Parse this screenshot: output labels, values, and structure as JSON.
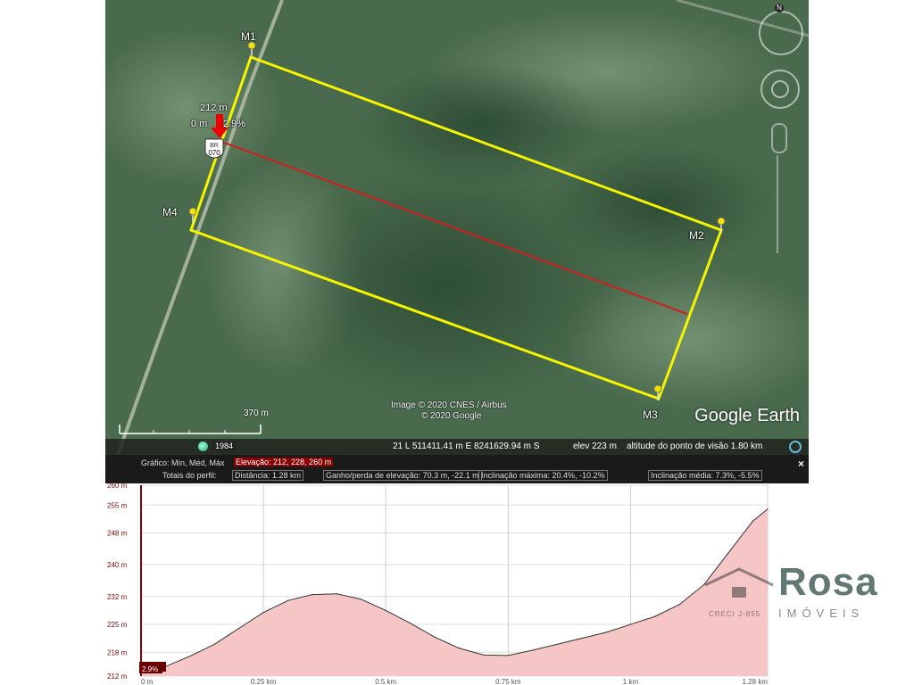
{
  "map": {
    "markers": [
      {
        "name": "m1",
        "label": "M1"
      },
      {
        "name": "m2",
        "label": "M2"
      },
      {
        "name": "m3",
        "label": "M3"
      },
      {
        "name": "m4",
        "label": "M4"
      }
    ],
    "cursor": {
      "elevation": "212 m",
      "distance": "0 m",
      "slope": "2.9%"
    },
    "road_shield": {
      "top": "BR",
      "number": "070"
    },
    "credits": {
      "imagery": "Image © 2020 CNES / Airbus",
      "copyright": "© 2020 Google"
    },
    "logo": "Google Earth",
    "scale_label": "370 m",
    "compass": "N"
  },
  "statusbar": {
    "year": "1984",
    "coords": "21 L 511411.41 m E 8241629.94 m S",
    "elev": "elev  223 m",
    "eye_alt": "altitude do ponto de visão   1.80 km"
  },
  "panel": {
    "graph_label": "Gráfico: Mín, Méd, Máx",
    "elevation_summary": "Elevação: 212, 228, 260 m",
    "totals_label": "Totais do perfil:",
    "distance": "Distância: 1.28 km",
    "gain_loss": "Ganho/perda de elevação: 70.3 m, -22.1 m",
    "max_slope": "Inclinação máxima: 20.4%, -10.2%",
    "avg_slope": "Inclinação média: 7.3%, -5.5%",
    "close": "×",
    "cursor_elev": "212 m",
    "cursor_slope": "2.9%"
  },
  "chart_data": {
    "type": "area",
    "xlabel": "",
    "ylabel": "",
    "x_unit": "km",
    "x_ticks": [
      {
        "value": 0,
        "label": "0 m"
      },
      {
        "value": 0.25,
        "label": "0.25 km"
      },
      {
        "value": 0.5,
        "label": "0.5 km"
      },
      {
        "value": 0.75,
        "label": "0.75 km"
      },
      {
        "value": 1.0,
        "label": "1 km"
      },
      {
        "value": 1.28,
        "label": "1.28 km"
      }
    ],
    "y_ticks": [
      {
        "value": 212,
        "label": "212 m"
      },
      {
        "value": 218,
        "label": "218 m"
      },
      {
        "value": 225,
        "label": "225 m"
      },
      {
        "value": 232,
        "label": "232 m"
      },
      {
        "value": 240,
        "label": "240 m"
      },
      {
        "value": 248,
        "label": "248 m"
      },
      {
        "value": 255,
        "label": "255 m"
      },
      {
        "value": 260,
        "label": "260 m"
      }
    ],
    "xlim": [
      0,
      1.28
    ],
    "ylim": [
      212,
      260
    ],
    "grid": true,
    "area_color": "#f6c5c5",
    "line_color": "#333333",
    "x": [
      0,
      0.05,
      0.1,
      0.15,
      0.2,
      0.25,
      0.3,
      0.35,
      0.4,
      0.45,
      0.5,
      0.55,
      0.6,
      0.65,
      0.7,
      0.75,
      0.8,
      0.85,
      0.9,
      0.95,
      1.0,
      1.05,
      1.1,
      1.15,
      1.2,
      1.25,
      1.28
    ],
    "y": [
      213,
      214.4,
      217,
      220,
      224,
      228,
      231,
      232.5,
      232.7,
      231.3,
      228.5,
      225.3,
      221.8,
      219,
      217.3,
      217.2,
      218.5,
      220,
      221.5,
      223,
      225,
      227,
      230,
      235,
      243,
      251,
      254
    ]
  }
}
